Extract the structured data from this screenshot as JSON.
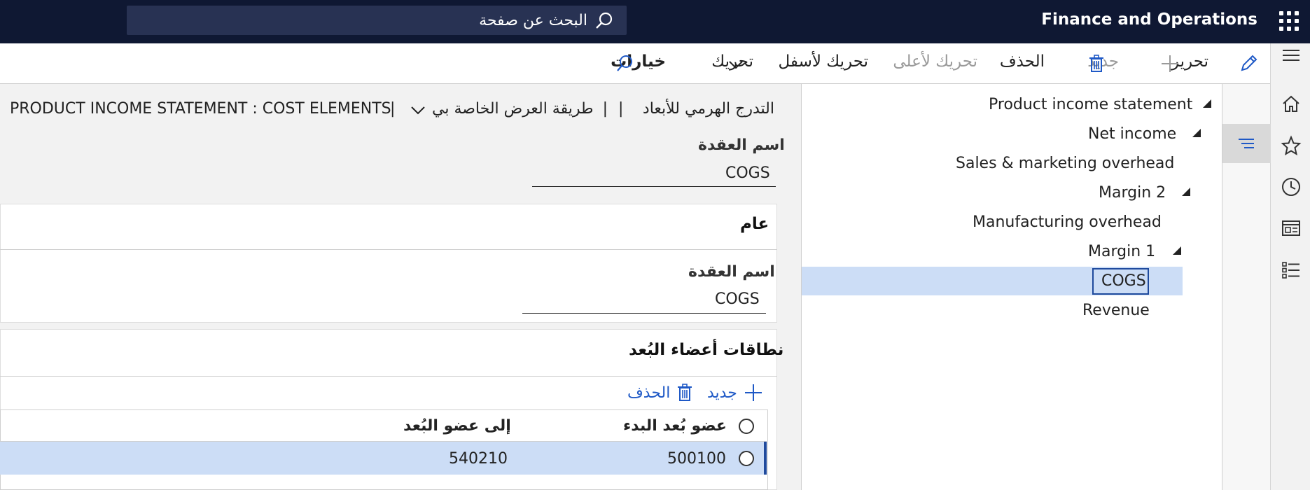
{
  "topbar": {
    "app_title": "Finance and Operations",
    "search_label": "البحث عن صفحة"
  },
  "toolbar": {
    "edit": "تحرير",
    "new": "جديد",
    "delete": "الحذف",
    "move_up": "تحريك لأعلى",
    "move_down": "تحريك لأسفل",
    "move": "تحريك",
    "options": "خيارات"
  },
  "tree": {
    "nodes": [
      {
        "label": "Product income statement",
        "expanded": true
      },
      {
        "label": "Net income",
        "expanded": true
      },
      {
        "label": "Sales & marketing overhead",
        "expanded": false
      },
      {
        "label": "Margin 2",
        "expanded": true
      },
      {
        "label": "Manufacturing overhead",
        "expanded": false
      },
      {
        "label": "Margin 1",
        "expanded": true
      },
      {
        "label": "COGS",
        "expanded": false,
        "selected": true
      },
      {
        "label": "Revenue",
        "expanded": false
      }
    ]
  },
  "details": {
    "breadcrumb": {
      "hierarchy": "التدرج الهرمي للأبعاد",
      "view": "طريقة العرض الخاصة بي",
      "separator": "|",
      "path": "PRODUCT INCOME STATEMENT : COST ELEMENTS"
    },
    "node_name_label": "اسم العقدة",
    "node_name_value": "COGS",
    "general_section": {
      "title": "عام",
      "node_name_label": "اسم العقدة",
      "node_name_value": "COGS"
    },
    "ranges_section": {
      "title": "نطاقات أعضاء البُعد",
      "new": "جديد",
      "delete": "الحذف",
      "columns": {
        "from": "عضو بُعد البدء",
        "to": "إلى عضو البُعد"
      },
      "rows": [
        {
          "from": "500100",
          "to": "540210"
        }
      ]
    }
  },
  "colors": {
    "topbar": "#0f1833",
    "search_bg": "#283253",
    "accent": "#1f59c6",
    "selection": "#ccddf6"
  }
}
